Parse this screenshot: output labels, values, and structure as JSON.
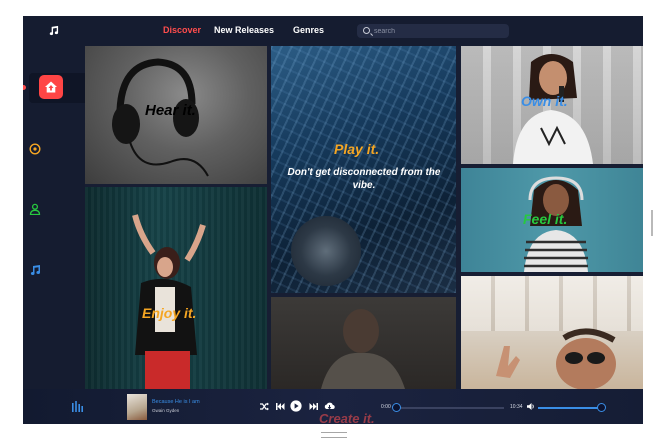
{
  "topbar": {
    "logo_icon": "music-note-icon",
    "nav": [
      {
        "label": "Discover",
        "active": true
      },
      {
        "label": "New Releases",
        "active": false
      },
      {
        "label": "Genres",
        "active": false
      }
    ],
    "search": {
      "placeholder": "search",
      "value": ""
    }
  },
  "sidebar": {
    "items": [
      {
        "icon": "home-icon",
        "active": true,
        "color": "#ff4545"
      },
      {
        "icon": "disc-icon",
        "color": "#f5a623"
      },
      {
        "icon": "user-icon",
        "color": "#27c93f"
      },
      {
        "icon": "music-note-icon",
        "color": "#3a8ee6"
      }
    ]
  },
  "tiles": {
    "hear": {
      "label": "Hear it.",
      "color": "#ffffff"
    },
    "play": {
      "label": "Play it.",
      "color": "#f5a623",
      "subtitle": "Don't get disconnected from the vibe."
    },
    "own": {
      "label": "Own it.",
      "color": "#3a8ee6"
    },
    "feel": {
      "label": "Feel it.",
      "color": "#27c93f"
    },
    "enjoy": {
      "label": "Enjoy it.",
      "color": "#f5a623"
    },
    "create": {
      "label": "Create it."
    }
  },
  "player": {
    "track_title": "Because He is I am",
    "artist": "Gwain Gyden",
    "time_current": "0:00",
    "time_total": "10:34",
    "progress": 0,
    "volume": 1.0,
    "accent": "#3a8ee6"
  }
}
